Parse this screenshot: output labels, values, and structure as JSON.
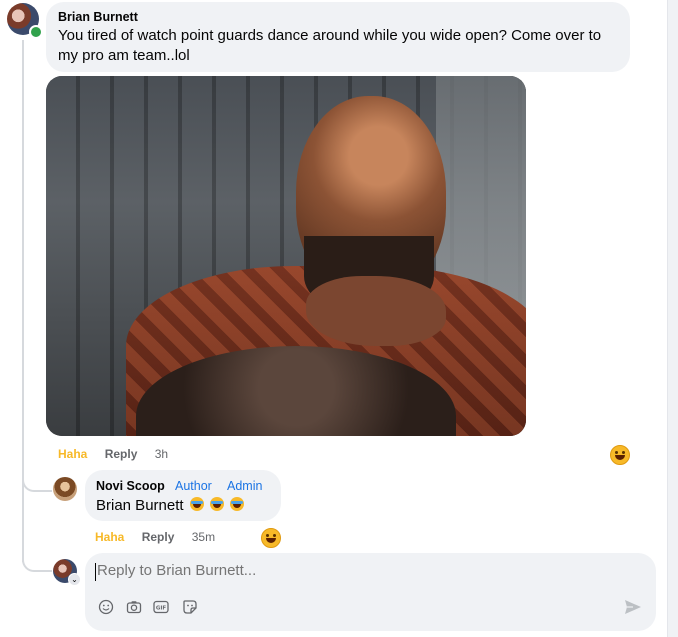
{
  "comment": {
    "author": "Brian Burnett",
    "text": "You tired of watch point guards dance around while you wide open? Come over to my pro am team..lol",
    "actions": {
      "reaction_label": "Haha",
      "reply_label": "Reply",
      "time": "3h"
    },
    "reaction_icon": "laughing-emoji-icon"
  },
  "reply": {
    "author": "Novi Scoop",
    "badges": [
      "Author",
      "Admin"
    ],
    "text": "Brian Burnett",
    "emojis": [
      "laughing-with-tears",
      "laughing-with-tears",
      "laughing-with-tears"
    ],
    "actions": {
      "reaction_label": "Haha",
      "reply_label": "Reply",
      "time": "35m"
    }
  },
  "composer": {
    "placeholder": "Reply to Brian Burnett...",
    "tools": [
      "emoji-icon",
      "camera-icon",
      "gif-icon",
      "sticker-icon"
    ],
    "send_icon": "send-icon"
  },
  "colors": {
    "bubble": "#f0f2f5",
    "haha": "#f7b928",
    "badge": "#1b74e4",
    "muted": "#65676b"
  }
}
